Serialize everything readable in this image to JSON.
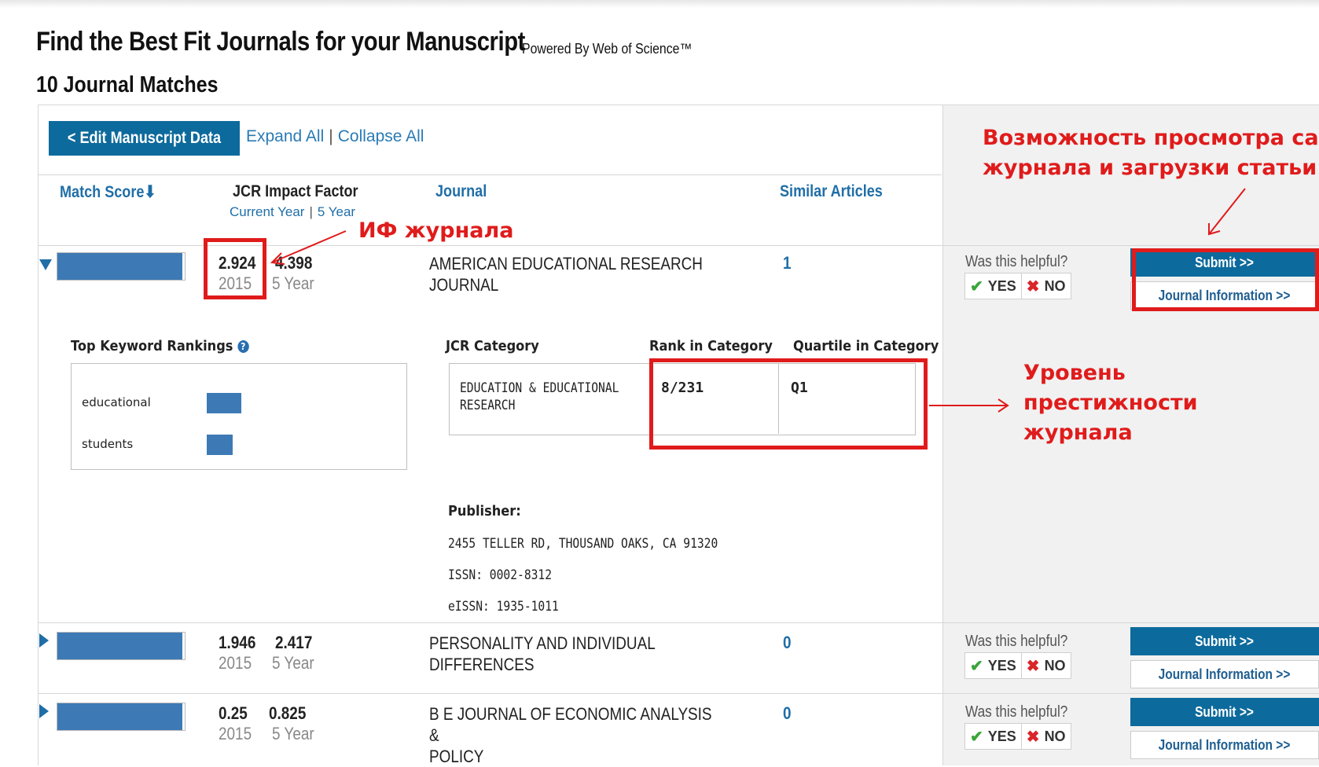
{
  "header": {
    "title": "Find the Best Fit Journals for your Manuscript",
    "powered_by": "Powered By Web of Science™",
    "matches": "10 Journal Matches"
  },
  "toolbar": {
    "edit_label": "< Edit Manuscript Data",
    "expand_all": "Expand All",
    "separator": "|",
    "collapse_all": "Collapse All"
  },
  "columns": {
    "match_score": "Match Score",
    "jcr_impact_factor": "JCR Impact Factor",
    "current_year": "Current Year",
    "five_year": "5 Year",
    "journal": "Journal",
    "similar_articles": "Similar Articles"
  },
  "results": [
    {
      "match_score_fraction": 0.98,
      "impact_current": "2.924",
      "year": "2015",
      "impact_5y": "4.398",
      "five_year_label": "5 Year",
      "journal_line1": "AMERICAN EDUCATIONAL RESEARCH",
      "journal_line2": "JOURNAL",
      "similar": "1",
      "expanded": true
    },
    {
      "match_score_fraction": 0.98,
      "impact_current": "1.946",
      "year": "2015",
      "impact_5y": "2.417",
      "five_year_label": "5 Year",
      "journal_line1": "PERSONALITY AND INDIVIDUAL",
      "journal_line2": "DIFFERENCES",
      "similar": "0",
      "expanded": false
    },
    {
      "match_score_fraction": 0.98,
      "impact_current": "0.25",
      "year": "2015",
      "impact_5y": "0.825",
      "five_year_label": "5 Year",
      "journal_line1": "B E JOURNAL OF ECONOMIC ANALYSIS &",
      "journal_line2": "POLICY",
      "similar": "0",
      "expanded": false
    }
  ],
  "feedback": {
    "helpful": "Was this helpful?",
    "yes": "YES",
    "no": "NO",
    "submit": "Submit >>",
    "journal_information": "Journal Information >>"
  },
  "details": {
    "top_keyword_rankings": "Top Keyword Rankings",
    "keywords": [
      {
        "label": "educational",
        "fraction": 1.0
      },
      {
        "label": "students",
        "fraction": 0.75
      }
    ],
    "jcr_category_label": "JCR Category",
    "rank_label": "Rank in Category",
    "quartile_label": "Quartile in Category",
    "category_line1": "EDUCATION & EDUCATIONAL",
    "category_line2": "RESEARCH",
    "rank": "8/231",
    "quartile": "Q1",
    "publisher_label": "Publisher:",
    "address": "2455 TELLER RD, THOUSAND OAKS, CA 91320",
    "issn": "ISSN: 0002-8312",
    "eissn": "eISSN: 1935-1011"
  },
  "annotations": {
    "if_label": "ИФ журнала",
    "site_line1": "Возможность просмотра сайта",
    "site_line2": "журнала и загрузки статьи",
    "prestige_line1": "Уровень",
    "prestige_line2": "престижности",
    "prestige_line3": "журнала",
    "color": "#e01b1b"
  },
  "colors": {
    "accent": "#0d6a9c",
    "bar": "#3d7ab5",
    "link": "#1f6ea7"
  }
}
